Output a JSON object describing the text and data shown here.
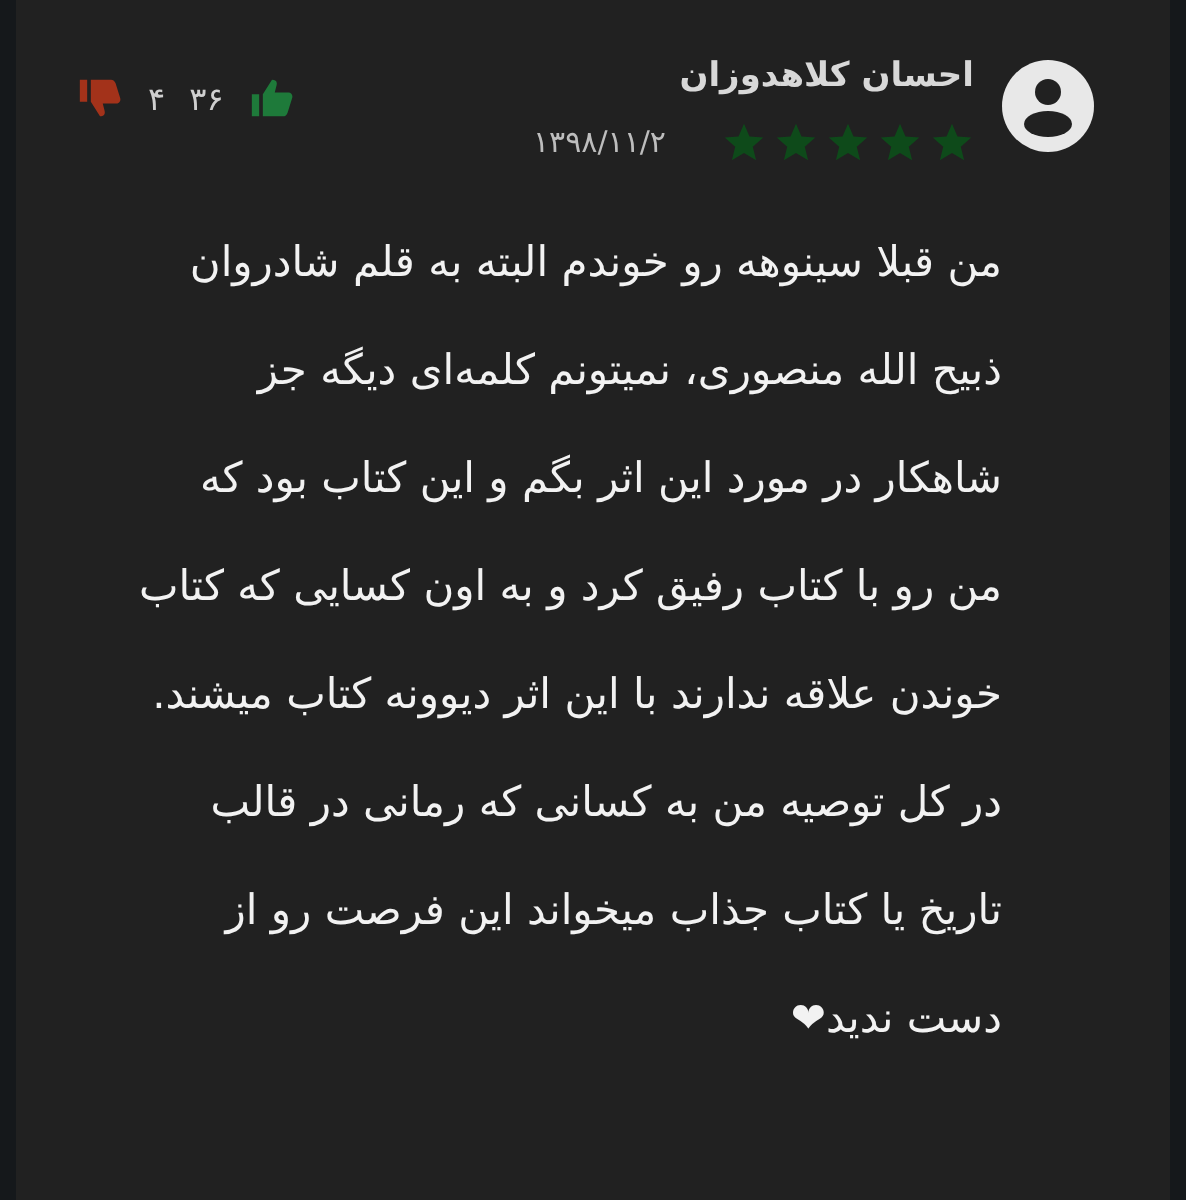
{
  "review": {
    "author": "احسان کلاهدوزان",
    "stars": 5,
    "date": "۱۳۹۸/۱۱/۲",
    "likes": "۳۶",
    "dislikes": "۴",
    "body": "من قبلا سینوهه رو خوندم البته به قلم شادروان ذبیح الله منصوری، نمیتونم کلمه‌ای دیگه جز شاهکار در مورد این اثر بگم و این کتاب بود که من رو با کتاب رفیق کرد و به اون کسایی که کتاب خوندن علاقه ندارند با این اثر دیوونه کتاب میشند. در کل توصیه من به کسانی که رمانی در قالب تاریخ یا کتاب جذاب میخواند این فرصت رو از دست ندید❤"
  }
}
